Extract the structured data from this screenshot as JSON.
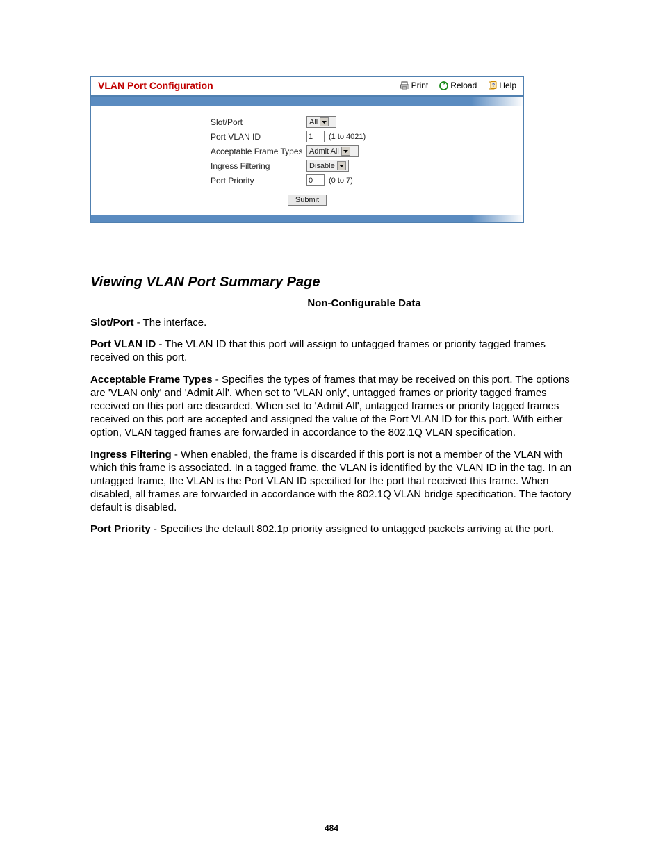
{
  "panel": {
    "title": "VLAN Port Configuration",
    "tools": {
      "print": "Print",
      "reload": "Reload",
      "help": "Help"
    },
    "form": {
      "slot_port": {
        "label": "Slot/Port",
        "value": "All"
      },
      "port_vlan_id": {
        "label": "Port VLAN ID",
        "value": "1",
        "hint": "(1 to 4021)"
      },
      "frame_types": {
        "label": "Acceptable Frame Types",
        "value": "Admit All"
      },
      "ingress": {
        "label": "Ingress Filtering",
        "value": "Disable"
      },
      "port_priority": {
        "label": "Port Priority",
        "value": "0",
        "hint": "(0 to 7)"
      },
      "submit": "Submit"
    }
  },
  "section": {
    "heading": "Viewing VLAN Port Summary Page",
    "subhead": "Non-Configurable Data",
    "defs": {
      "slot_port": {
        "term": "Slot/Port",
        "text": " - The interface."
      },
      "port_vlan_id": {
        "term": "Port VLAN ID",
        "text": " - The VLAN ID that this port will assign to untagged frames or priority tagged frames received on this port."
      },
      "frame_types": {
        "term": "Acceptable Frame Types",
        "text": " - Specifies the types of frames that may be received on this port. The options are 'VLAN only' and 'Admit All'. When set to 'VLAN only', untagged frames or priority tagged frames received on this port are discarded. When set to 'Admit All', untagged frames or priority tagged frames received on this port are accepted and assigned the value of the Port VLAN ID for this port. With either option, VLAN tagged frames are forwarded in accordance to the 802.1Q VLAN specification."
      },
      "ingress": {
        "term": "Ingress Filtering",
        "text": " - When enabled, the frame is discarded if this port is not a member of the VLAN with which this frame is associated. In a tagged frame, the VLAN is identified by the VLAN ID in the tag. In an untagged frame, the VLAN is the Port VLAN ID specified for the port that received this frame. When disabled, all frames are forwarded in accordance with the 802.1Q VLAN bridge specification. The factory default is disabled."
      },
      "port_priority": {
        "term": "Port Priority",
        "text": " - Specifies the default 802.1p priority assigned to untagged packets arriving at the port."
      }
    }
  },
  "page_number": "484"
}
